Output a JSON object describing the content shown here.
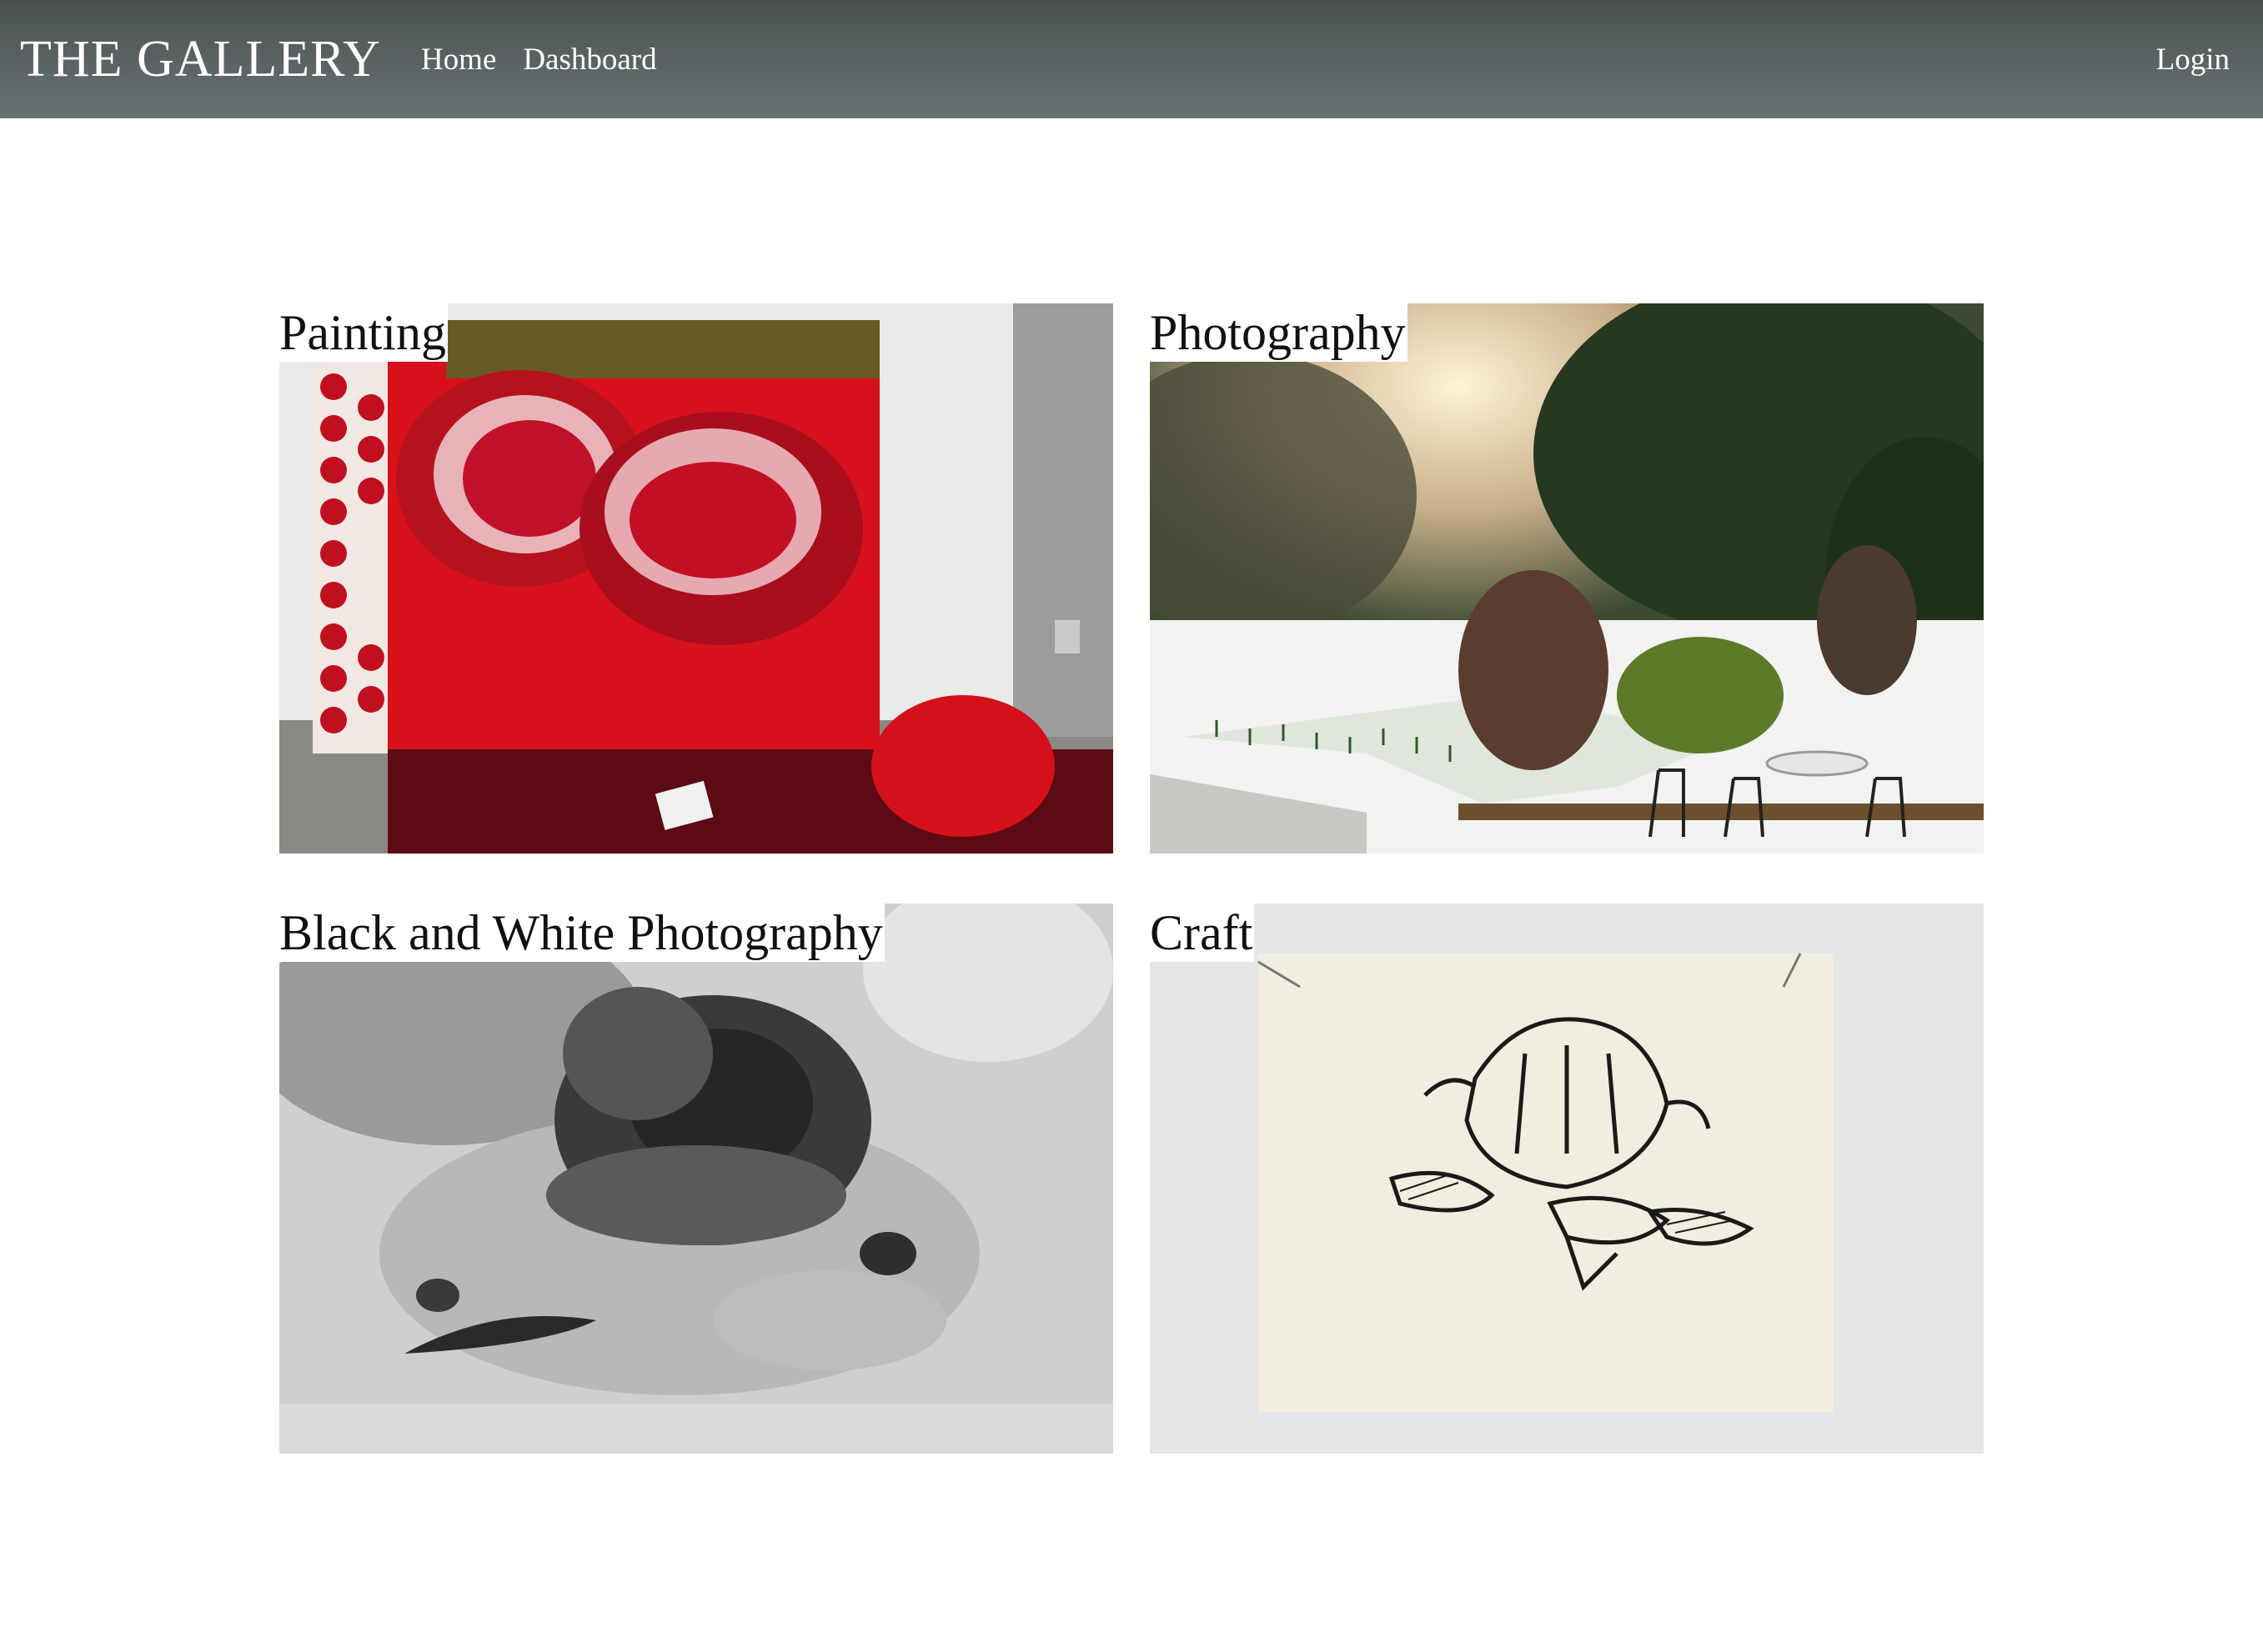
{
  "navbar": {
    "brand": "THE GALLERY",
    "links": [
      {
        "label": "Home"
      },
      {
        "label": "Dashboard"
      }
    ],
    "login_label": "Login"
  },
  "gallery": {
    "cards": [
      {
        "title": "Painting",
        "image_icon": "painting-image"
      },
      {
        "title": "Photography",
        "image_icon": "photography-image"
      },
      {
        "title": "Black and White Photography",
        "image_icon": "bw-photography-image"
      },
      {
        "title": "Craft",
        "image_icon": "craft-image"
      }
    ]
  }
}
